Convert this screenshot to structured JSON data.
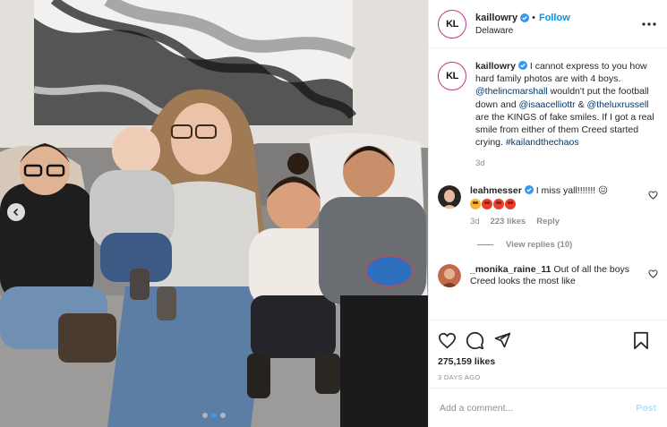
{
  "header": {
    "avatar_initials": "KL",
    "username": "kaillowry",
    "follow_separator": "•",
    "follow_label": "Follow",
    "location": "Delaware"
  },
  "caption": {
    "username": "kaillowry",
    "text_1": " I cannot express to you how hard family photos are with 4 boys. ",
    "mention_1": "@thelincmarshall",
    "text_2": " wouldn't put the football down and ",
    "mention_2": "@isaacelliottr",
    "text_3": " & ",
    "mention_3": "@theluxrussell",
    "text_4": " are the KINGS of fake smiles. If I got a real smile from either of them Creed started crying. ",
    "hashtag": "#kailandthechaos",
    "time": "3d"
  },
  "comments": [
    {
      "username": "leahmesser",
      "text": " I miss yall!!!!!!! 😖",
      "emojis": [
        "crying-emoji",
        "heart-eyes-emoji",
        "heart-eyes-emoji",
        "heart-eyes-emoji"
      ],
      "time": "3d",
      "likes": "223 likes",
      "reply": "Reply",
      "view_replies": "View replies (10)"
    },
    {
      "username": "_monika_raine_11",
      "text": " Out of all the boys Creed looks the most like"
    }
  ],
  "actions": {
    "likes": "275,159 likes",
    "date": "3 DAYS AGO"
  },
  "add_comment": {
    "placeholder": "Add a comment...",
    "post_label": "Post"
  },
  "photo": {
    "description_icon": "family-photo"
  },
  "colors": {
    "accent": "#0095f6",
    "verified": "#3897f0",
    "post_disabled": "#b2dffc",
    "muted": "#8e8e8e"
  }
}
